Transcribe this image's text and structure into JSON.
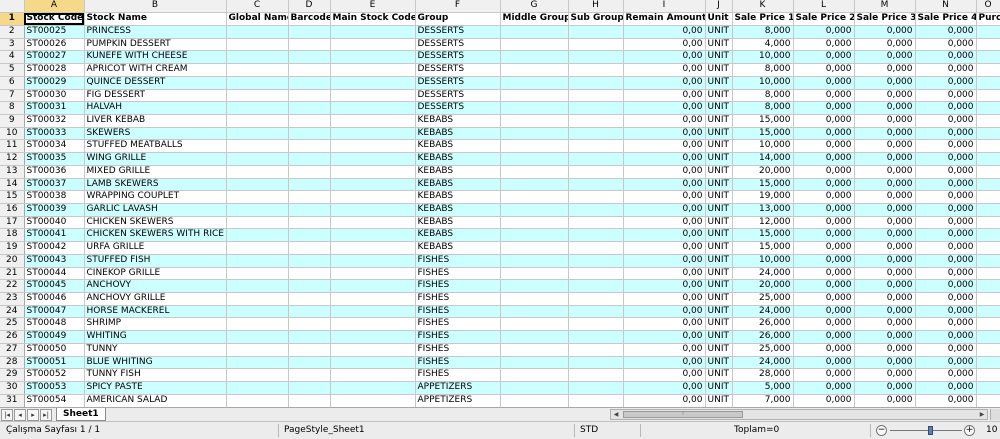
{
  "columns": [
    "A",
    "B",
    "C",
    "D",
    "E",
    "F",
    "G",
    "H",
    "I",
    "J",
    "K",
    "L",
    "M",
    "N",
    "O"
  ],
  "active_column": "A",
  "active_row": "1",
  "header_row": [
    "Stock Code",
    "Stock Name",
    "Global Name",
    "Barcode",
    "Main Stock Code",
    "Group",
    "Middle Group",
    "Sub Group",
    "Remain Amount",
    "Unit",
    "Sale Price 1",
    "Sale Price 2",
    "Sale Price 3",
    "Sale Price 4",
    "Purc"
  ],
  "rows": [
    [
      "ST00025",
      "PRINCESS",
      "DESSERTS",
      "0,00",
      "UNIT",
      "8,000"
    ],
    [
      "ST00026",
      "PUMPKIN DESSERT",
      "DESSERTS",
      "0,00",
      "UNIT",
      "4,000"
    ],
    [
      "ST00027",
      "KÜNEFE WITH CHEESE",
      "DESSERTS",
      "0,00",
      "UNIT",
      "10,000"
    ],
    [
      "ST00028",
      "APRİCOT WITH CREAM",
      "DESSERTS",
      "0,00",
      "UNIT",
      "8,000"
    ],
    [
      "ST00029",
      "QUINCE DESSERT",
      "DESSERTS",
      "0,00",
      "UNIT",
      "10,000"
    ],
    [
      "ST00030",
      "FIG DESSERT",
      "DESSERTS",
      "0,00",
      "UNIT",
      "8,000"
    ],
    [
      "ST00031",
      "HALVAH",
      "DESSERTS",
      "0,00",
      "UNIT",
      "8,000"
    ],
    [
      "ST00032",
      "LIVER KEBAB",
      "KEBABS",
      "0,00",
      "UNIT",
      "15,000"
    ],
    [
      "ST00033",
      "SKEWERS",
      "KEBABS",
      "0,00",
      "UNIT",
      "15,000"
    ],
    [
      "ST00034",
      "STUFFED MEATBALLS",
      "KEBABS",
      "0,00",
      "UNIT",
      "10,000"
    ],
    [
      "ST00035",
      "WING GRILLE",
      "KEBABS",
      "0,00",
      "UNIT",
      "14,000"
    ],
    [
      "ST00036",
      "MIXED GRILLE",
      "KEBABS",
      "0,00",
      "UNIT",
      "20,000"
    ],
    [
      "ST00037",
      "LAMB SKEWERS",
      "KEBABS",
      "0,00",
      "UNIT",
      "15,000"
    ],
    [
      "ST00038",
      "WRAPPING COUPLET",
      "KEBABS",
      "0,00",
      "UNIT",
      "19,000"
    ],
    [
      "ST00039",
      "GARLIC LAVASH",
      "KEBABS",
      "0,00",
      "UNIT",
      "13,000"
    ],
    [
      "ST00040",
      "CHICKEN SKEWERS",
      "KEBABS",
      "0,00",
      "UNIT",
      "12,000"
    ],
    [
      "ST00041",
      "CHICKEN SKEWERS WITH RICE",
      "KEBABS",
      "0,00",
      "UNIT",
      "15,000"
    ],
    [
      "ST00042",
      "URFA GRILLE",
      "KEBABS",
      "0,00",
      "UNIT",
      "15,000"
    ],
    [
      "ST00043",
      "STUFFED FISH",
      "FISHES",
      "0,00",
      "UNIT",
      "10,000"
    ],
    [
      "ST00044",
      "CINEKOP GRILLE",
      "FISHES",
      "0,00",
      "UNIT",
      "24,000"
    ],
    [
      "ST00045",
      "ANCHOVY",
      "FISHES",
      "0,00",
      "UNIT",
      "20,000"
    ],
    [
      "ST00046",
      "ANCHOVY GRILLE",
      "FISHES",
      "0,00",
      "UNIT",
      "25,000"
    ],
    [
      "ST00047",
      "HORSE MACKEREL",
      "FISHES",
      "0,00",
      "UNIT",
      "24,000"
    ],
    [
      "ST00048",
      "SHRIMP",
      "FISHES",
      "0,00",
      "UNIT",
      "26,000"
    ],
    [
      "ST00049",
      "WHITING",
      "FISHES",
      "0,00",
      "UNIT",
      "26,000"
    ],
    [
      "ST00050",
      "TUNNY",
      "FISHES",
      "0,00",
      "UNIT",
      "25,000"
    ],
    [
      "ST00051",
      "BLUE WHITING",
      "FISHES",
      "0,00",
      "UNIT",
      "24,000"
    ],
    [
      "ST00052",
      "TUNNY FISH",
      "FISHES",
      "0,00",
      "UNIT",
      "28,000"
    ],
    [
      "ST00053",
      "SPICY PASTE",
      "APPETIZERS",
      "0,00",
      "UNIT",
      "5,000"
    ],
    [
      "ST00054",
      "AMERICAN SALAD",
      "APPETIZERS",
      "0,00",
      "UNIT",
      "7,000"
    ]
  ],
  "zero_price": "0,000",
  "tab_nav": [
    "|◂",
    "◂",
    "▸",
    "▸|"
  ],
  "sheet_tab": "Sheet1",
  "status": {
    "sheet_info": "Çalışma Sayfası 1 / 1",
    "page_style": "PageStyle_Sheet1",
    "mode": "STD",
    "sum": "Toplam=0",
    "zoom_percent": "10"
  },
  "colors": {
    "cyan_row": "#ccffff",
    "header_bg": "#f0f0f0",
    "active_header": "#f5d889"
  }
}
